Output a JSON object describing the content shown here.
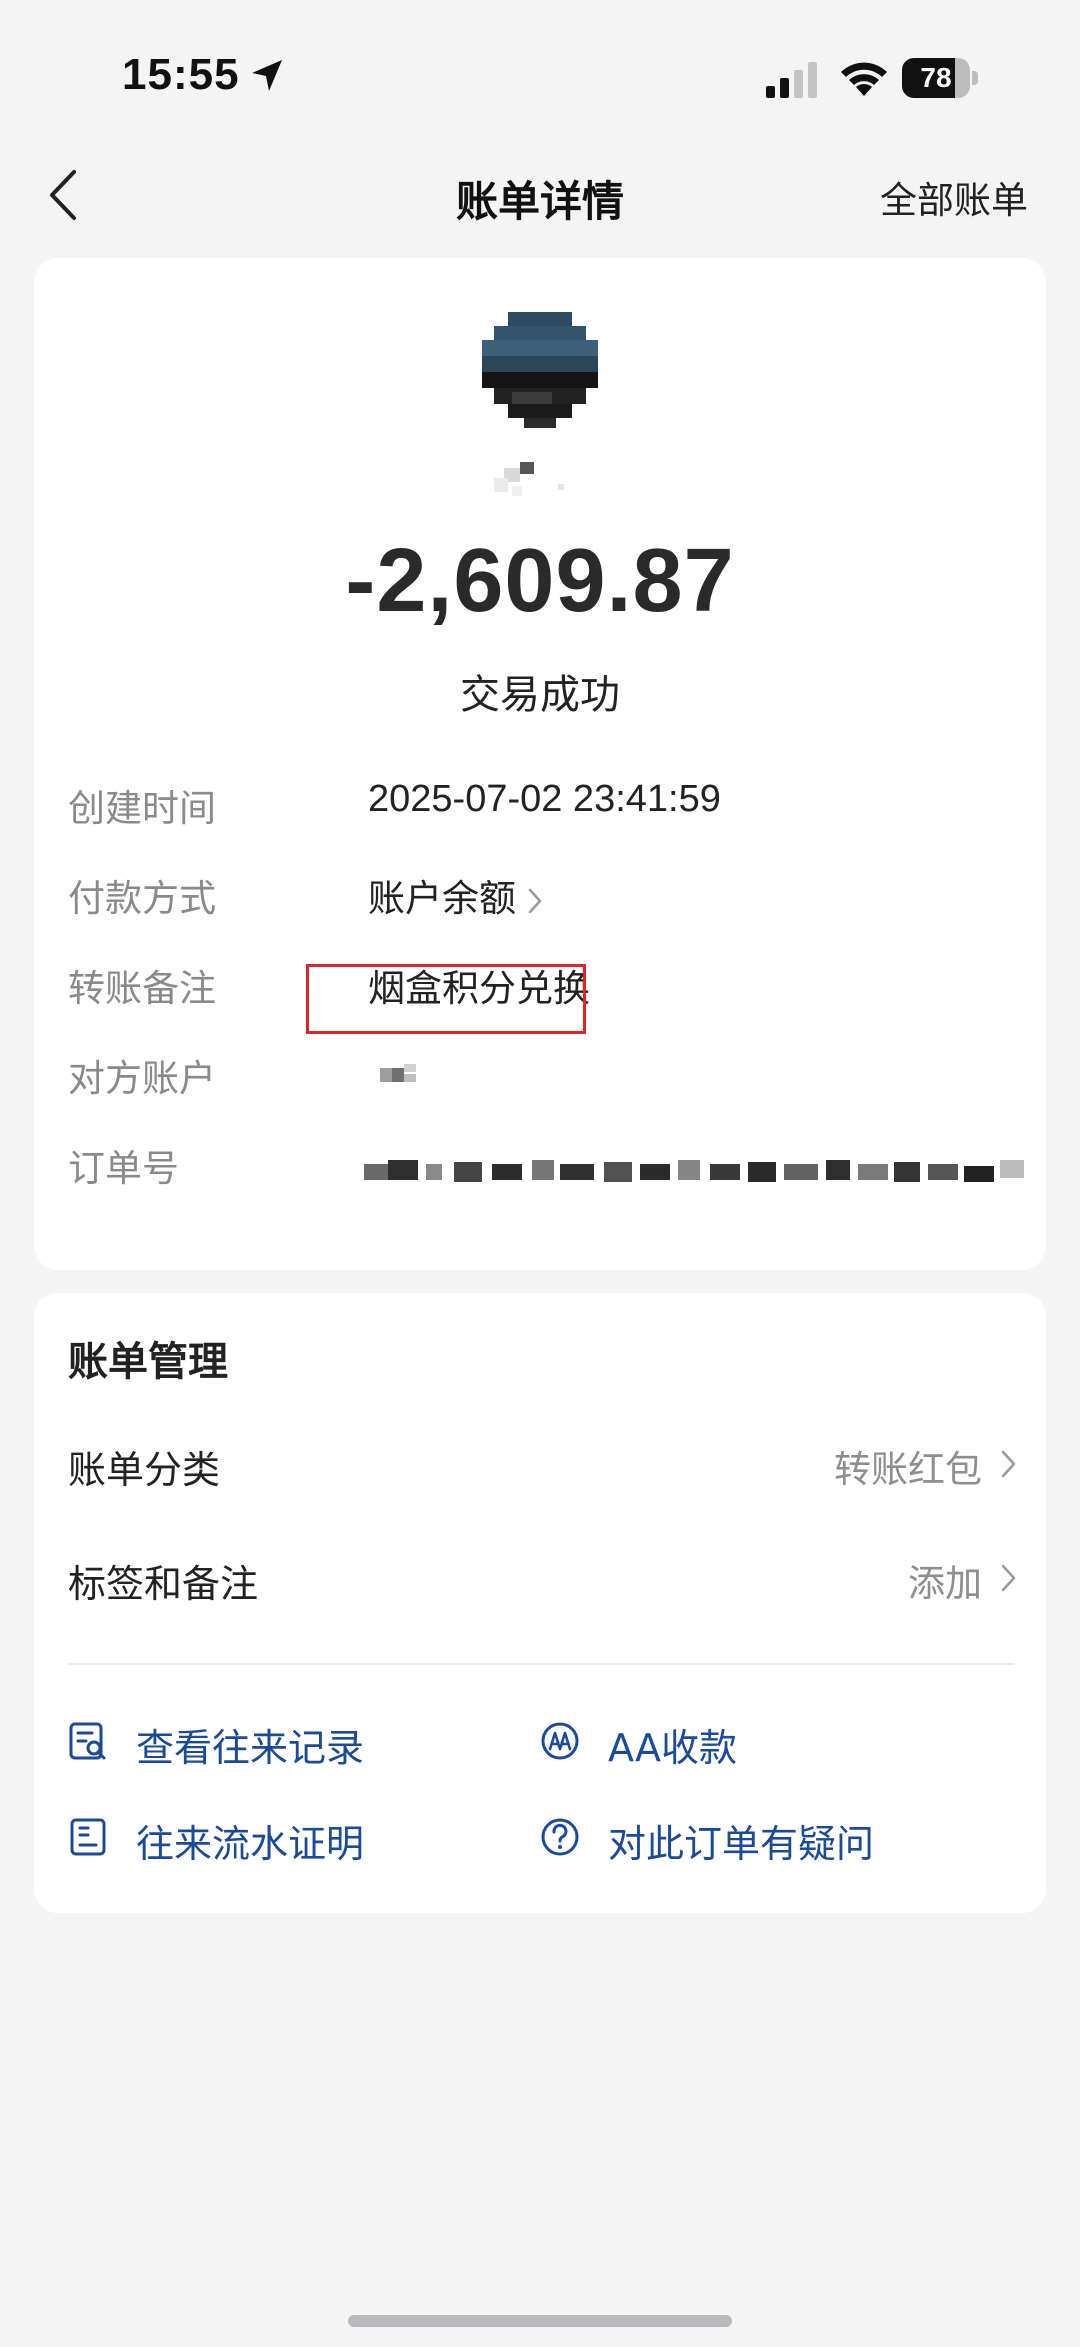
{
  "status_bar": {
    "time": "15:55",
    "battery": "78",
    "battery_level": 0.78
  },
  "nav": {
    "title": "账单详情",
    "right_link": "全部账单"
  },
  "detail": {
    "amount": "-2,609.87",
    "status": "交易成功",
    "rows": [
      {
        "label": "创建时间",
        "value": "2025-07-02 23:41:59"
      },
      {
        "label": "付款方式",
        "value": "账户余额"
      },
      {
        "label": "转账备注",
        "value": "烟盒积分兑换"
      },
      {
        "label": "对方账户",
        "value": ""
      },
      {
        "label": "订单号",
        "value": ""
      }
    ]
  },
  "manage": {
    "title": "账单管理",
    "rows": [
      {
        "label": "账单分类",
        "value": "转账红包"
      },
      {
        "label": "标签和备注",
        "value": "添加"
      }
    ],
    "actions": [
      {
        "label": "查看往来记录",
        "icon": "search-record-icon"
      },
      {
        "label": "AA收款",
        "icon": "aa-icon"
      },
      {
        "label": "往来流水证明",
        "icon": "document-icon"
      },
      {
        "label": "对此订单有疑问",
        "icon": "question-icon"
      }
    ]
  },
  "colors": {
    "accent_blue": "#1b4a9a",
    "highlight_red": "#e0242b",
    "background": "#f4f4f5"
  }
}
